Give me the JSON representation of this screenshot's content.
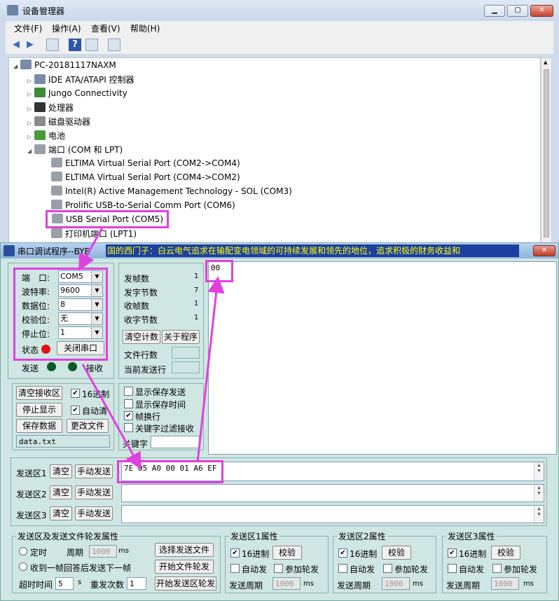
{
  "device_manager": {
    "title": "设备管理器",
    "window_buttons": {
      "min": "▁",
      "max": "▢",
      "close": "✕"
    },
    "menu": [
      "文件(F)",
      "操作(A)",
      "查看(V)",
      "帮助(H)"
    ],
    "toolbar_icons": [
      "back-icon",
      "forward-icon",
      "show-hide-icon",
      "help-icon",
      "properties-icon",
      "scan-hardware-icon"
    ],
    "tree": {
      "root": "PC-20181117NAXM",
      "categories": [
        {
          "label": "IDE ATA/ATAPI 控制器",
          "icon": "ide-controller-icon"
        },
        {
          "label": "Jungo Connectivity",
          "icon": "jungo-icon"
        },
        {
          "label": "处理器",
          "icon": "processor-icon"
        },
        {
          "label": "磁盘驱动器",
          "icon": "disk-drive-icon"
        },
        {
          "label": "电池",
          "icon": "battery-icon"
        },
        {
          "label": "端口 (COM 和 LPT)",
          "icon": "port-icon"
        }
      ],
      "ports": [
        "ELTIMA Virtual Serial Port (COM2->COM4)",
        "ELTIMA Virtual Serial Port (COM4->COM2)",
        "Intel(R) Active Management Technology - SOL (COM3)",
        "Prolific USB-to-Serial Comm Port (COM6)",
        "USB Serial Port (COM5)",
        "打印机端口 (LPT1)"
      ]
    }
  },
  "serial_tool": {
    "title": "串口调试程序--BYE",
    "marquee": "国的西门子：白云电气追求在输配变电领域的可持续发展和领先的地位，追求积极的财务收益和",
    "settings": {
      "port_label": "端　口:",
      "port_value": "COM5",
      "baud_label": "波特率:",
      "baud_value": "9600",
      "data_label": "数据位:",
      "data_value": "8",
      "parity_label": "校验位:",
      "parity_value": "无",
      "stop_label": "停止位:",
      "stop_value": "1",
      "status_label": "状态",
      "close_port": "关闭串口",
      "send_label": "发送",
      "recv_label": "接收"
    },
    "stats": {
      "sent_frames_label": "发帧数",
      "sent_frames": "1",
      "sent_bytes_label": "发字节数",
      "sent_bytes": "7",
      "recv_frames_label": "收帧数",
      "recv_frames": "1",
      "recv_bytes_label": "收字节数",
      "recv_bytes": "1",
      "clear_count": "清空计数",
      "about": "关于程序",
      "file_lines_label": "文件行数",
      "current_line_label": "当前发送行"
    },
    "recv_area": "00",
    "recv_options": {
      "clear_recv": "清空接收区",
      "hex": "16进制",
      "stop_display": "停止显示",
      "auto_clear": "自动清",
      "save_data": "保存数据",
      "change_file": "更改文件",
      "file_name": "data.txt"
    },
    "display_options": {
      "show_saved_send": "显示保存发送",
      "show_saved_time": "显示保存时间",
      "frame_newline": "帧换行",
      "keyword_filter": "关键字过滤接收",
      "keyword_label": "关键字"
    },
    "send_areas": [
      {
        "label": "发送区1",
        "clear": "清空",
        "manual": "手动发送",
        "value": "7E 05 A0 00 01 A6 EF"
      },
      {
        "label": "发送区2",
        "clear": "清空",
        "manual": "手动发送",
        "value": ""
      },
      {
        "label": "发送区3",
        "clear": "清空",
        "manual": "手动发送",
        "value": ""
      }
    ],
    "file_send": {
      "group_title": "发送区及发送文件轮发属性",
      "timed": "定时",
      "period_label": "周期",
      "period_value": "1000",
      "ms": "ms",
      "next_after_frame": "收到一帧回答后发送下一帧",
      "timeout_label": "超时时间",
      "timeout_value": "5",
      "s": "s",
      "retry_label": "重发次数",
      "retry_value": "1",
      "select_file": "选择发送文件",
      "start_file_cycle": "开始文件轮发",
      "start_area_cycle": "开始发送区轮发"
    },
    "area_props": [
      {
        "title": "发送区1属性",
        "hex": "16进制",
        "check": "校验",
        "auto": "自动发",
        "join": "参加轮发",
        "period_label": "发送周期",
        "period": "1000",
        "ms": "ms"
      },
      {
        "title": "发送区2属性",
        "hex": "16进制",
        "check": "校验",
        "auto": "自动发",
        "join": "参加轮发",
        "period_label": "发送周期",
        "period": "1000",
        "ms": "ms"
      },
      {
        "title": "发送区3属性",
        "hex": "16进制",
        "check": "校验",
        "auto": "自动发",
        "join": "参加轮发",
        "period_label": "发送周期",
        "period": "1000",
        "ms": "ms"
      }
    ],
    "colors": {
      "led_red": "#e01010",
      "led_green": "#0a5a20",
      "annotation": "#e040e0",
      "title_bar": "#1c3fa0"
    }
  }
}
